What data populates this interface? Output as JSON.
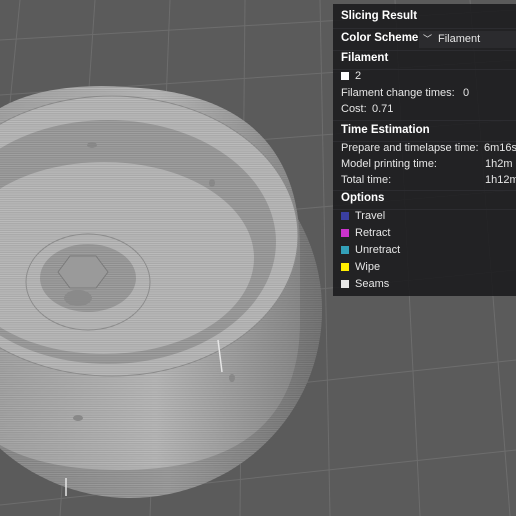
{
  "panel": {
    "title": "Slicing Result",
    "color_scheme_label": "Color Scheme",
    "color_scheme_value": "Filament",
    "filament": {
      "header": "Filament",
      "item": "2",
      "item_color": "#ffffff",
      "change_times_label": "Filament change times:",
      "change_times_value": "0",
      "cost_label": "Cost:",
      "cost_value": "0.71"
    },
    "time": {
      "header": "Time Estimation",
      "prepare_label": "Prepare and timelapse time:",
      "prepare_value": "6m16s",
      "model_label": "Model printing time:",
      "model_value": "1h2m",
      "total_label": "Total time:",
      "total_value": "1h12m"
    },
    "options": {
      "header": "Options",
      "items": [
        {
          "label": "Travel",
          "color": "#3a3fa0"
        },
        {
          "label": "Retract",
          "color": "#cc33cc"
        },
        {
          "label": "Unretract",
          "color": "#33a0b8"
        },
        {
          "label": "Wipe",
          "color": "#ffee00"
        },
        {
          "label": "Seams",
          "color": "#e8e8e8"
        }
      ]
    }
  }
}
